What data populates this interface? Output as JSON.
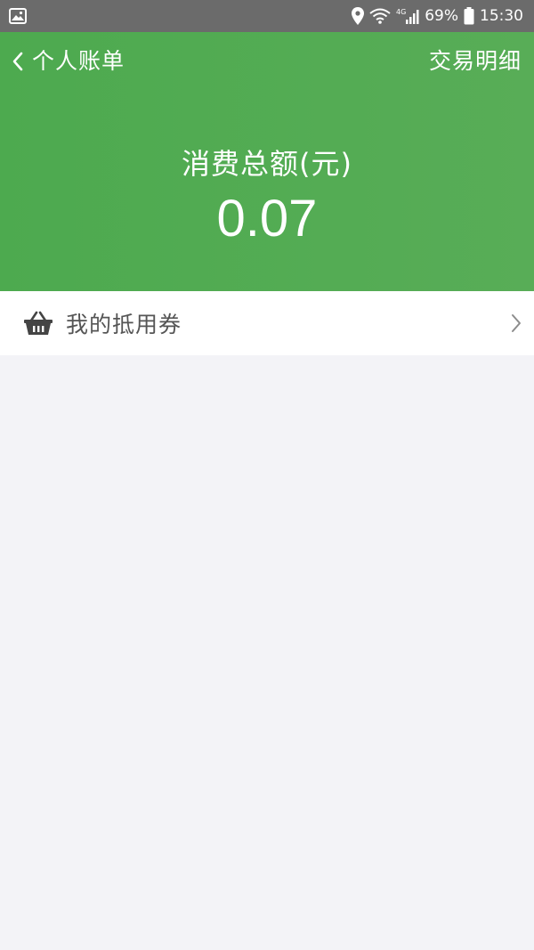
{
  "status_bar": {
    "battery": "69%",
    "time": "15:30",
    "network": "4G"
  },
  "header": {
    "title": "个人账单",
    "action": "交易明细",
    "summary_label": "消费总额(元)",
    "summary_value": "0.07",
    "color": "#4daa4f"
  },
  "coupons": {
    "label": "我的抵用券"
  },
  "icons": [
    "image-icon",
    "location-icon",
    "wifi-icon",
    "signal-icon",
    "battery-icon",
    "back-chevron-icon",
    "basket-icon",
    "chevron-right-icon"
  ]
}
